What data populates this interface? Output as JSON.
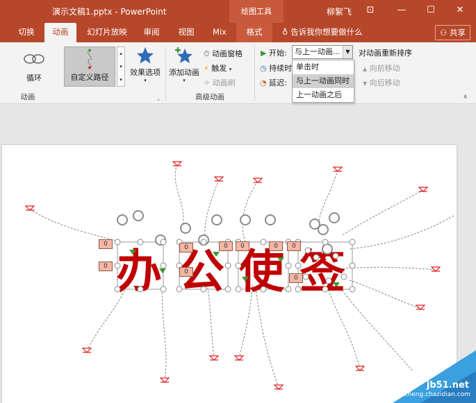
{
  "window": {
    "title": "演示文稿1.pptx - PowerPoint",
    "context_tools": "绘图工具",
    "user": "柳絮飞",
    "minimize": "—",
    "restore": "☐",
    "close": "✕",
    "ribbon_options": "⊡"
  },
  "tabs": {
    "transitions": "切换",
    "animations": "动画",
    "slideshow": "幻灯片放映",
    "review": "审阅",
    "view": "视图",
    "mix": "Mix",
    "format": "格式",
    "tellme": "告诉我你想要做什么",
    "share": "共享"
  },
  "ribbon": {
    "animation_group": {
      "loop": "循环",
      "custom_path": "自定义路径",
      "effect_options": "效果选项",
      "label": "动画"
    },
    "advanced_group": {
      "add_animation": "添加动画",
      "animation_pane": "动画窗格",
      "trigger": "触发",
      "animation_painter": "动画刷",
      "label": "高级动画"
    },
    "timing": {
      "start_label": "开始:",
      "start_value": "与上一动画...",
      "duration_label": "持续时",
      "delay_label": "延迟:",
      "reorder": "对动画重新排序",
      "move_earlier": "向前移动",
      "move_later": "向后移动"
    },
    "start_menu": [
      "单击时",
      "与上一动画同时",
      "上一动画之后"
    ]
  },
  "slide": {
    "text_chars": [
      "办",
      "公",
      "使",
      "签"
    ],
    "animation_tags": [
      "0",
      "0",
      "0",
      "0",
      "0",
      "0",
      "0",
      "0",
      "0"
    ]
  },
  "watermark": {
    "host": "jb51.net",
    "text": "查字典 教程网 jiaocheng.chazidian.com"
  },
  "colors": {
    "accent": "#b7472a",
    "text_red": "#c00000",
    "tag_fill": "#f4b7a4",
    "path_red": "#e02020"
  }
}
